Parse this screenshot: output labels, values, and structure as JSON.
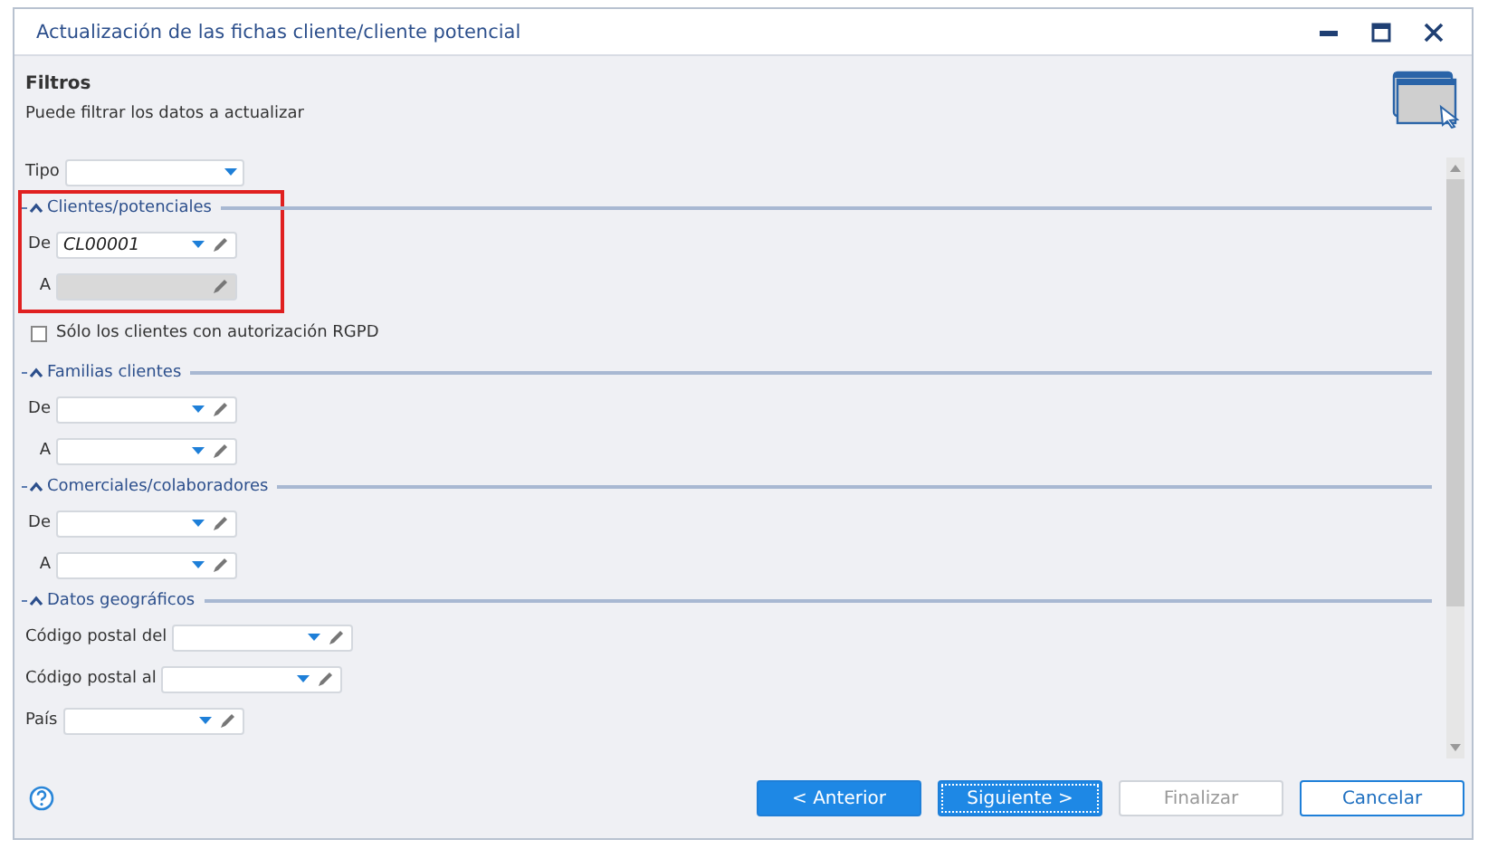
{
  "window": {
    "title": "Actualización de las fichas cliente/cliente potencial"
  },
  "header": {
    "title": "Filtros",
    "subtitle": "Puede filtrar los datos a actualizar"
  },
  "form": [
    {
      "kind": "select",
      "label": "Tipo",
      "disabled": false
    },
    {
      "kind": "section",
      "title": "Clientes/potenciales",
      "expanded": true,
      "highlighted": true,
      "items": [
        {
          "kind": "lookup",
          "label": "De",
          "value": "CL00001",
          "disabled": false
        },
        {
          "kind": "lookup",
          "label": "A",
          "disabled": true
        }
      ]
    },
    {
      "kind": "checkbox",
      "label": "Sólo los clientes con autorización RGPD",
      "checked": false
    },
    {
      "kind": "section",
      "title": "Familias clientes",
      "expanded": true,
      "highlighted": false,
      "items": [
        {
          "kind": "lookup",
          "label": "De",
          "disabled": false
        },
        {
          "kind": "lookup",
          "label": "A",
          "disabled": false
        }
      ]
    },
    {
      "kind": "section",
      "title": "Comerciales/colaboradores",
      "expanded": true,
      "highlighted": false,
      "items": [
        {
          "kind": "lookup",
          "label": "De",
          "disabled": false
        },
        {
          "kind": "lookup",
          "label": "A",
          "disabled": false
        }
      ]
    },
    {
      "kind": "section",
      "title": "Datos geográficos",
      "expanded": true,
      "highlighted": false,
      "items": [
        {
          "kind": "lookup",
          "label": "Código postal del",
          "disabled": false
        },
        {
          "kind": "lookup",
          "label": "Código postal al",
          "disabled": false
        },
        {
          "kind": "lookup",
          "label": "País",
          "disabled": false
        }
      ]
    }
  ],
  "buttons": [
    {
      "label": "< Anterior",
      "kind": "primary",
      "disabled": false,
      "focused": false
    },
    {
      "label": "Siguiente >",
      "kind": "primary",
      "disabled": false,
      "focused": true
    },
    {
      "label": "Finalizar",
      "kind": "secondary",
      "disabled": true,
      "focused": false
    },
    {
      "label": "Cancelar",
      "kind": "secondary",
      "disabled": false,
      "focused": false
    }
  ]
}
